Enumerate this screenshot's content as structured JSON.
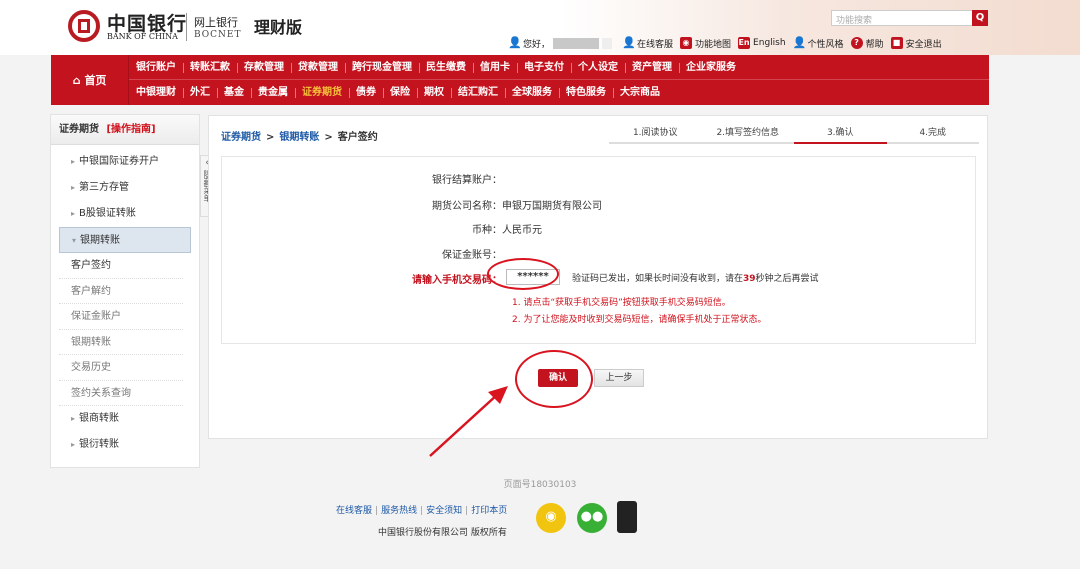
{
  "header": {
    "bank_name_cn": "中国银行",
    "bank_name_en": "BANK OF CHINA",
    "ebank_cn": "网上银行",
    "ebank_en": "BOCNET",
    "edition": "理财版",
    "search_placeholder": "功能搜索",
    "greeting": "您好，",
    "links": {
      "online_service": "在线客服",
      "site_map": "功能地图",
      "english": "English",
      "personal_style": "个性风格",
      "help": "帮助",
      "logout": "安全退出"
    }
  },
  "nav": {
    "home": "首页",
    "row1": [
      "银行账户",
      "转账汇款",
      "存款管理",
      "贷款管理",
      "跨行现金管理",
      "民生缴费",
      "信用卡",
      "电子支付",
      "个人设定",
      "资产管理",
      "企业家服务"
    ],
    "row2": [
      "中银理财",
      "外汇",
      "基金",
      "贵金属",
      "证券期货",
      "债券",
      "保险",
      "期权",
      "结汇购汇",
      "全球服务",
      "特色服务",
      "大宗商品"
    ],
    "active": "证券期货"
  },
  "sidebar": {
    "title": "证券期货",
    "guide": "[操作指南]",
    "items": [
      {
        "label": "中银国际证券开户",
        "level": 1
      },
      {
        "label": "第三方存管",
        "level": 1
      },
      {
        "label": "B股银证转账",
        "level": 1
      },
      {
        "label": "银期转账",
        "level": 1,
        "open": true
      },
      {
        "label": "客户签约",
        "level": 2,
        "current": true
      },
      {
        "label": "客户解约",
        "level": 2
      },
      {
        "label": "保证金账户",
        "level": 2
      },
      {
        "label": "银期转账",
        "level": 2
      },
      {
        "label": "交易历史",
        "level": 2
      },
      {
        "label": "签约关系查询",
        "level": 2
      },
      {
        "label": "银商转账",
        "level": 1
      },
      {
        "label": "银衍转账",
        "level": 1
      }
    ],
    "collapse_label": "隐藏菜单"
  },
  "main": {
    "breadcrumb": [
      "证券期货",
      "银期转账",
      "客户签约"
    ],
    "steps": [
      "1.阅读协议",
      "2.填写签约信息",
      "3.确认",
      "4.完成"
    ],
    "active_step": "3.确认",
    "form": {
      "settlement_account_label": "银行结算账户：",
      "settlement_account_value": "",
      "futures_company_label": "期货公司名称：",
      "futures_company_value": "申银万国期货有限公司",
      "currency_label": "币种：",
      "currency_value": "人民币元",
      "margin_account_label": "保证金账号：",
      "margin_account_value": "",
      "sms_label": "请输入手机交易码：",
      "sms_value": "******",
      "sms_info_before": "验证码已发出，如果长时间没有收到，请在",
      "countdown": "39",
      "sms_info_after": "秒钟之后再尝试",
      "tip1": "1. 请点击“获取手机交易码”按钮获取手机交易码短信。",
      "tip2": "2. 为了让您能及时收到交易码短信，请确保手机处于正常状态。"
    },
    "confirm_button": "确认",
    "back_button": "上一步"
  },
  "footer": {
    "page_no": "页面号18030103",
    "links": [
      "在线客服",
      "服务热线",
      "安全须知",
      "打印本页"
    ],
    "copyright": "中国银行股份有限公司  版权所有"
  },
  "colors": {
    "brand_red": "#c3131f",
    "link_blue": "#1f5aa6"
  }
}
